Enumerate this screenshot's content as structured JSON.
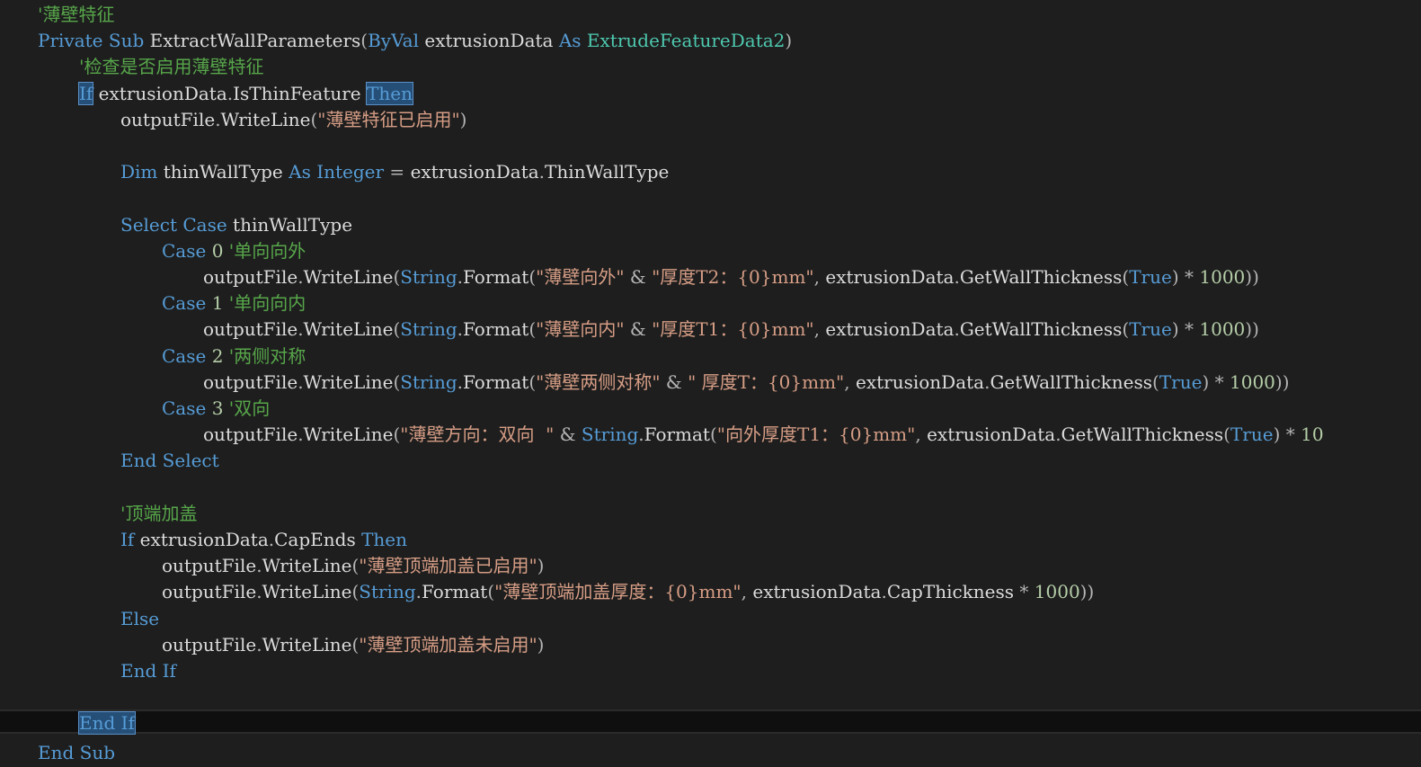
{
  "lines": [
    {
      "indent": 0,
      "tokens": [
        {
          "t": "'薄壁特征",
          "c": "cm"
        }
      ]
    },
    {
      "indent": 0,
      "tokens": [
        {
          "t": "Private",
          "c": "kw"
        },
        {
          "t": " ",
          "c": "id"
        },
        {
          "t": "Sub",
          "c": "kw"
        },
        {
          "t": " ExtractWallParameters",
          "c": "id"
        },
        {
          "t": "(",
          "c": "op"
        },
        {
          "t": "ByVal",
          "c": "kw"
        },
        {
          "t": " extrusionData ",
          "c": "id"
        },
        {
          "t": "As",
          "c": "kw"
        },
        {
          "t": " ",
          "c": "id"
        },
        {
          "t": "ExtrudeFeatureData2",
          "c": "ty"
        },
        {
          "t": ")",
          "c": "op"
        }
      ]
    },
    {
      "indent": 1,
      "tokens": [
        {
          "t": "'检查是否启用薄壁特征",
          "c": "cm"
        }
      ]
    },
    {
      "indent": 1,
      "tokens": [
        {
          "t": "If",
          "c": "kw",
          "hl": true
        },
        {
          "t": " extrusionData",
          "c": "id"
        },
        {
          "t": ".",
          "c": "op"
        },
        {
          "t": "IsThinFeature ",
          "c": "id"
        },
        {
          "t": "Then",
          "c": "kw",
          "hl": true
        }
      ]
    },
    {
      "indent": 2,
      "tokens": [
        {
          "t": "outputFile",
          "c": "id"
        },
        {
          "t": ".",
          "c": "op"
        },
        {
          "t": "WriteLine",
          "c": "id"
        },
        {
          "t": "(",
          "c": "op"
        },
        {
          "t": "\"薄壁特征已启用\"",
          "c": "st"
        },
        {
          "t": ")",
          "c": "op"
        }
      ]
    },
    {
      "indent": 0,
      "tokens": []
    },
    {
      "indent": 2,
      "tokens": [
        {
          "t": "Dim",
          "c": "kw"
        },
        {
          "t": " thinWallType ",
          "c": "id"
        },
        {
          "t": "As",
          "c": "kw"
        },
        {
          "t": " ",
          "c": "id"
        },
        {
          "t": "Integer",
          "c": "kw"
        },
        {
          "t": " = ",
          "c": "op"
        },
        {
          "t": "extrusionData",
          "c": "id"
        },
        {
          "t": ".",
          "c": "op"
        },
        {
          "t": "ThinWallType",
          "c": "id"
        }
      ]
    },
    {
      "indent": 0,
      "tokens": []
    },
    {
      "indent": 2,
      "tokens": [
        {
          "t": "Select",
          "c": "kw"
        },
        {
          "t": " ",
          "c": "id"
        },
        {
          "t": "Case",
          "c": "kw"
        },
        {
          "t": " thinWallType",
          "c": "id"
        }
      ]
    },
    {
      "indent": 3,
      "tokens": [
        {
          "t": "Case",
          "c": "kw"
        },
        {
          "t": " ",
          "c": "id"
        },
        {
          "t": "0",
          "c": "nu"
        },
        {
          "t": " ",
          "c": "id"
        },
        {
          "t": "'单向向外",
          "c": "cm"
        }
      ]
    },
    {
      "indent": 4,
      "tokens": [
        {
          "t": "outputFile",
          "c": "id"
        },
        {
          "t": ".",
          "c": "op"
        },
        {
          "t": "WriteLine",
          "c": "id"
        },
        {
          "t": "(",
          "c": "op"
        },
        {
          "t": "String",
          "c": "kw"
        },
        {
          "t": ".",
          "c": "op"
        },
        {
          "t": "Format",
          "c": "id"
        },
        {
          "t": "(",
          "c": "op"
        },
        {
          "t": "\"薄壁向外\"",
          "c": "st"
        },
        {
          "t": " & ",
          "c": "op"
        },
        {
          "t": "\"厚度T2：{0}mm\"",
          "c": "st"
        },
        {
          "t": ", ",
          "c": "op"
        },
        {
          "t": "extrusionData",
          "c": "id"
        },
        {
          "t": ".",
          "c": "op"
        },
        {
          "t": "GetWallThickness",
          "c": "id"
        },
        {
          "t": "(",
          "c": "op"
        },
        {
          "t": "True",
          "c": "kw"
        },
        {
          "t": ") * ",
          "c": "op"
        },
        {
          "t": "1000",
          "c": "nu"
        },
        {
          "t": "))",
          "c": "op"
        }
      ]
    },
    {
      "indent": 3,
      "tokens": [
        {
          "t": "Case",
          "c": "kw"
        },
        {
          "t": " ",
          "c": "id"
        },
        {
          "t": "1",
          "c": "nu"
        },
        {
          "t": " ",
          "c": "id"
        },
        {
          "t": "'单向向内",
          "c": "cm"
        }
      ]
    },
    {
      "indent": 4,
      "tokens": [
        {
          "t": "outputFile",
          "c": "id"
        },
        {
          "t": ".",
          "c": "op"
        },
        {
          "t": "WriteLine",
          "c": "id"
        },
        {
          "t": "(",
          "c": "op"
        },
        {
          "t": "String",
          "c": "kw"
        },
        {
          "t": ".",
          "c": "op"
        },
        {
          "t": "Format",
          "c": "id"
        },
        {
          "t": "(",
          "c": "op"
        },
        {
          "t": "\"薄壁向内\"",
          "c": "st"
        },
        {
          "t": " & ",
          "c": "op"
        },
        {
          "t": "\"厚度T1：{0}mm\"",
          "c": "st"
        },
        {
          "t": ", ",
          "c": "op"
        },
        {
          "t": "extrusionData",
          "c": "id"
        },
        {
          "t": ".",
          "c": "op"
        },
        {
          "t": "GetWallThickness",
          "c": "id"
        },
        {
          "t": "(",
          "c": "op"
        },
        {
          "t": "True",
          "c": "kw"
        },
        {
          "t": ") * ",
          "c": "op"
        },
        {
          "t": "1000",
          "c": "nu"
        },
        {
          "t": "))",
          "c": "op"
        }
      ]
    },
    {
      "indent": 3,
      "tokens": [
        {
          "t": "Case",
          "c": "kw"
        },
        {
          "t": " ",
          "c": "id"
        },
        {
          "t": "2",
          "c": "nu"
        },
        {
          "t": " ",
          "c": "id"
        },
        {
          "t": "'两侧对称",
          "c": "cm"
        }
      ]
    },
    {
      "indent": 4,
      "tokens": [
        {
          "t": "outputFile",
          "c": "id"
        },
        {
          "t": ".",
          "c": "op"
        },
        {
          "t": "WriteLine",
          "c": "id"
        },
        {
          "t": "(",
          "c": "op"
        },
        {
          "t": "String",
          "c": "kw"
        },
        {
          "t": ".",
          "c": "op"
        },
        {
          "t": "Format",
          "c": "id"
        },
        {
          "t": "(",
          "c": "op"
        },
        {
          "t": "\"薄壁两侧对称\"",
          "c": "st"
        },
        {
          "t": " & ",
          "c": "op"
        },
        {
          "t": "\" 厚度T：{0}mm\"",
          "c": "st"
        },
        {
          "t": ", ",
          "c": "op"
        },
        {
          "t": "extrusionData",
          "c": "id"
        },
        {
          "t": ".",
          "c": "op"
        },
        {
          "t": "GetWallThickness",
          "c": "id"
        },
        {
          "t": "(",
          "c": "op"
        },
        {
          "t": "True",
          "c": "kw"
        },
        {
          "t": ") * ",
          "c": "op"
        },
        {
          "t": "1000",
          "c": "nu"
        },
        {
          "t": "))",
          "c": "op"
        }
      ]
    },
    {
      "indent": 3,
      "tokens": [
        {
          "t": "Case",
          "c": "kw"
        },
        {
          "t": " ",
          "c": "id"
        },
        {
          "t": "3",
          "c": "nu"
        },
        {
          "t": " ",
          "c": "id"
        },
        {
          "t": "'双向",
          "c": "cm"
        }
      ]
    },
    {
      "indent": 4,
      "tokens": [
        {
          "t": "outputFile",
          "c": "id"
        },
        {
          "t": ".",
          "c": "op"
        },
        {
          "t": "WriteLine",
          "c": "id"
        },
        {
          "t": "(",
          "c": "op"
        },
        {
          "t": "\"薄壁方向：双向  \"",
          "c": "st"
        },
        {
          "t": " & ",
          "c": "op"
        },
        {
          "t": "String",
          "c": "kw"
        },
        {
          "t": ".",
          "c": "op"
        },
        {
          "t": "Format",
          "c": "id"
        },
        {
          "t": "(",
          "c": "op"
        },
        {
          "t": "\"向外厚度T1：{0}mm\"",
          "c": "st"
        },
        {
          "t": ", ",
          "c": "op"
        },
        {
          "t": "extrusionData",
          "c": "id"
        },
        {
          "t": ".",
          "c": "op"
        },
        {
          "t": "GetWallThickness",
          "c": "id"
        },
        {
          "t": "(",
          "c": "op"
        },
        {
          "t": "True",
          "c": "kw"
        },
        {
          "t": ") * ",
          "c": "op"
        },
        {
          "t": "10",
          "c": "nu"
        }
      ]
    },
    {
      "indent": 2,
      "tokens": [
        {
          "t": "End",
          "c": "kw"
        },
        {
          "t": " ",
          "c": "id"
        },
        {
          "t": "Select",
          "c": "kw"
        }
      ]
    },
    {
      "indent": 0,
      "tokens": []
    },
    {
      "indent": 2,
      "tokens": [
        {
          "t": "'顶端加盖",
          "c": "cm"
        }
      ]
    },
    {
      "indent": 2,
      "tokens": [
        {
          "t": "If",
          "c": "kw"
        },
        {
          "t": " extrusionData",
          "c": "id"
        },
        {
          "t": ".",
          "c": "op"
        },
        {
          "t": "CapEnds ",
          "c": "id"
        },
        {
          "t": "Then",
          "c": "kw"
        }
      ]
    },
    {
      "indent": 3,
      "tokens": [
        {
          "t": "outputFile",
          "c": "id"
        },
        {
          "t": ".",
          "c": "op"
        },
        {
          "t": "WriteLine",
          "c": "id"
        },
        {
          "t": "(",
          "c": "op"
        },
        {
          "t": "\"薄壁顶端加盖已启用\"",
          "c": "st"
        },
        {
          "t": ")",
          "c": "op"
        }
      ]
    },
    {
      "indent": 3,
      "tokens": [
        {
          "t": "outputFile",
          "c": "id"
        },
        {
          "t": ".",
          "c": "op"
        },
        {
          "t": "WriteLine",
          "c": "id"
        },
        {
          "t": "(",
          "c": "op"
        },
        {
          "t": "String",
          "c": "kw"
        },
        {
          "t": ".",
          "c": "op"
        },
        {
          "t": "Format",
          "c": "id"
        },
        {
          "t": "(",
          "c": "op"
        },
        {
          "t": "\"薄壁顶端加盖厚度：{0}mm\"",
          "c": "st"
        },
        {
          "t": ", ",
          "c": "op"
        },
        {
          "t": "extrusionData",
          "c": "id"
        },
        {
          "t": ".",
          "c": "op"
        },
        {
          "t": "CapThickness",
          "c": "id"
        },
        {
          "t": " * ",
          "c": "op"
        },
        {
          "t": "1000",
          "c": "nu"
        },
        {
          "t": "))",
          "c": "op"
        }
      ]
    },
    {
      "indent": 2,
      "tokens": [
        {
          "t": "Else",
          "c": "kw"
        }
      ]
    },
    {
      "indent": 3,
      "tokens": [
        {
          "t": "outputFile",
          "c": "id"
        },
        {
          "t": ".",
          "c": "op"
        },
        {
          "t": "WriteLine",
          "c": "id"
        },
        {
          "t": "(",
          "c": "op"
        },
        {
          "t": "\"薄壁顶端加盖未启用\"",
          "c": "st"
        },
        {
          "t": ")",
          "c": "op"
        }
      ]
    },
    {
      "indent": 2,
      "tokens": [
        {
          "t": "End",
          "c": "kw"
        },
        {
          "t": " ",
          "c": "id"
        },
        {
          "t": "If",
          "c": "kw"
        }
      ]
    },
    {
      "indent": 0,
      "tokens": []
    },
    {
      "indent": 1,
      "tokens": [
        {
          "t": "End If",
          "c": "kw",
          "hl": true
        }
      ]
    },
    {
      "indent": 0,
      "tokens": [
        {
          "t": "End",
          "c": "kw"
        },
        {
          "t": " ",
          "c": "id"
        },
        {
          "t": "Sub",
          "c": "kw"
        }
      ]
    }
  ]
}
